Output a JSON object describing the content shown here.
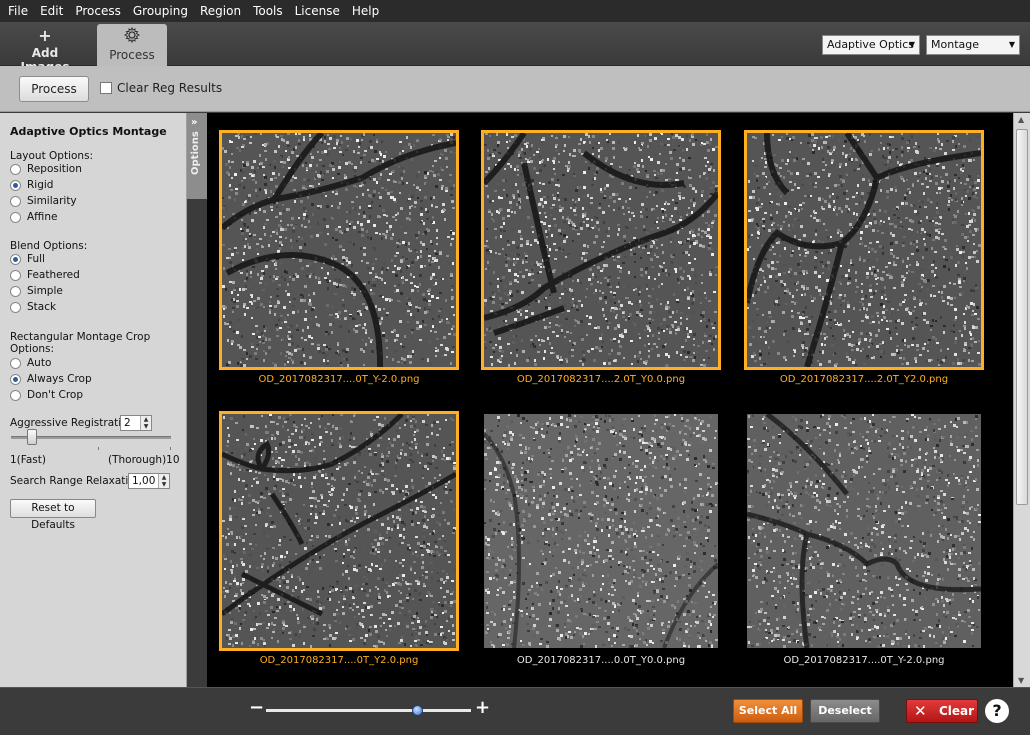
{
  "menu": [
    "File",
    "Edit",
    "Process",
    "Grouping",
    "Region",
    "Tools",
    "License",
    "Help"
  ],
  "toolbar": {
    "add_images_label": "Add Images",
    "process_label": "Process",
    "add_icon": "plus-icon",
    "process_icon": "gear-icon",
    "modality_select": "Adaptive Optics",
    "mode_select": "Montage"
  },
  "process_bar": {
    "process_button": "Process",
    "clear_reg_label": "Clear Reg Results",
    "clear_reg_checked": false
  },
  "options": {
    "tab_label": "Options",
    "title": "Adaptive Optics Montage",
    "layout_label": "Layout Options:",
    "layout_options": [
      "Reposition",
      "Rigid",
      "Similarity",
      "Affine"
    ],
    "layout_selected": "Rigid",
    "blend_label": "Blend Options:",
    "blend_options": [
      "Full",
      "Feathered",
      "Simple",
      "Stack"
    ],
    "blend_selected": "Full",
    "crop_label_1": "Rectangular Montage Crop",
    "crop_label_2": "Options:",
    "crop_options": [
      "Auto",
      "Always Crop",
      "Don't Crop"
    ],
    "crop_selected": "Always Crop",
    "aggressive_label": "Aggressive Registration:",
    "aggressive_value": "2",
    "slider_min_label": "1(Fast)",
    "slider_max_label": "(Thorough)10",
    "slider_value": 2,
    "relaxation_label": "Search Range Relaxation:",
    "relaxation_value": "1,00",
    "reset_button": "Reset to Defaults"
  },
  "images": [
    {
      "label": "OD_2017082317....0T_Y-2.0.png",
      "selected": true
    },
    {
      "label": "OD_2017082317....2.0T_Y0.0.png",
      "selected": true
    },
    {
      "label": "OD_2017082317....2.0T_Y2.0.png",
      "selected": true
    },
    {
      "label": "OD_2017082317....0T_Y2.0.png",
      "selected": true
    },
    {
      "label": "OD_2017082317....0.0T_Y0.0.png",
      "selected": false
    },
    {
      "label": "OD_2017082317....0T_Y-2.0.png",
      "selected": false
    }
  ],
  "bottom": {
    "zoom_minus": "−",
    "zoom_plus": "+",
    "zoom_level": 0.72,
    "select_all": "Select All",
    "deselect": "Deselect",
    "clear": "Clear",
    "help": "?"
  },
  "colors": {
    "selection": "#ffb020",
    "select_all_bg": "#e07020",
    "clear_bg": "#d02020"
  }
}
